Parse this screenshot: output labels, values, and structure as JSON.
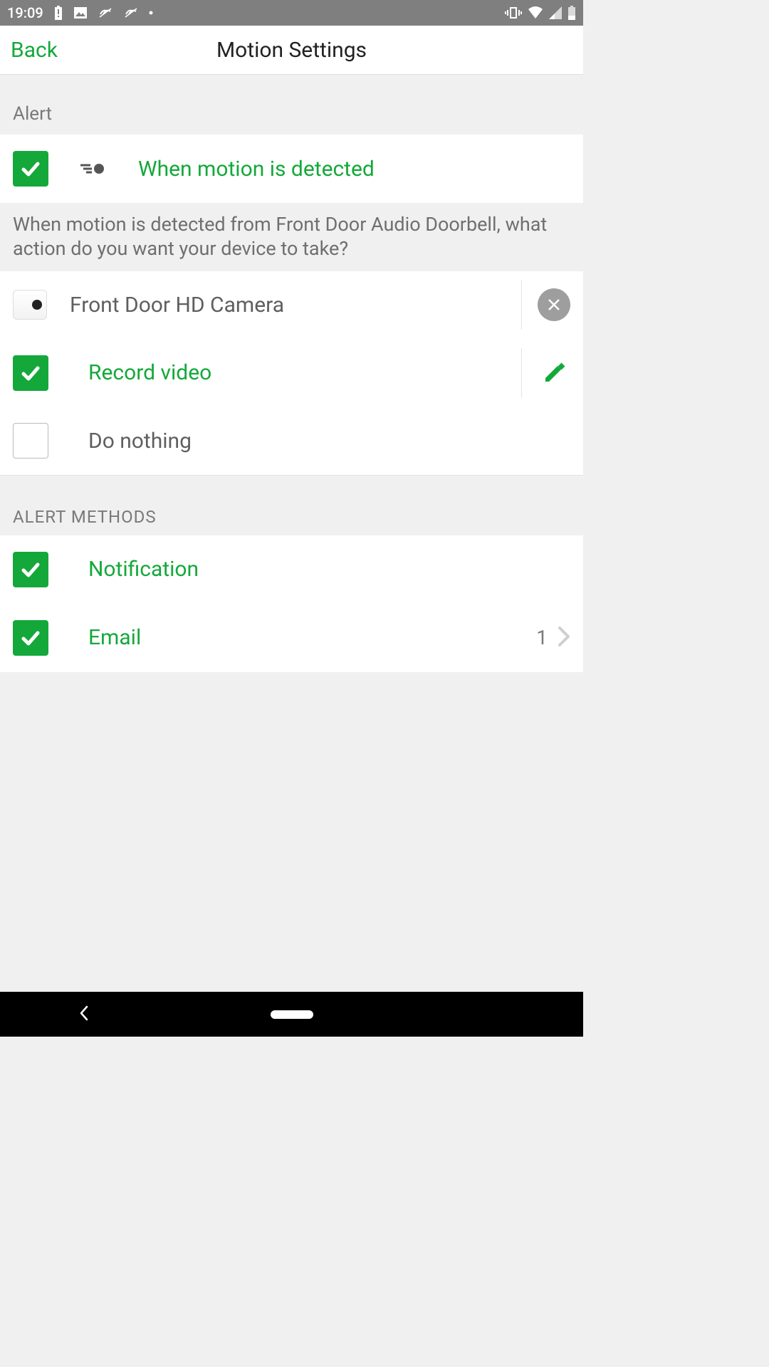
{
  "status": {
    "time": "19:09"
  },
  "nav": {
    "back": "Back",
    "title": "Motion Settings"
  },
  "alert": {
    "header": "Alert",
    "trigger_label": "When motion is detected",
    "description": "When motion is detected from Front Door Audio Doorbell, what action do you want your device to take?"
  },
  "device": {
    "name": "Front Door HD Camera"
  },
  "actions": {
    "record_video": "Record video",
    "do_nothing": "Do nothing"
  },
  "alert_methods": {
    "header": "ALERT METHODS",
    "notification": "Notification",
    "email": "Email",
    "email_count": "1"
  },
  "colors": {
    "accent": "#14a83a"
  }
}
